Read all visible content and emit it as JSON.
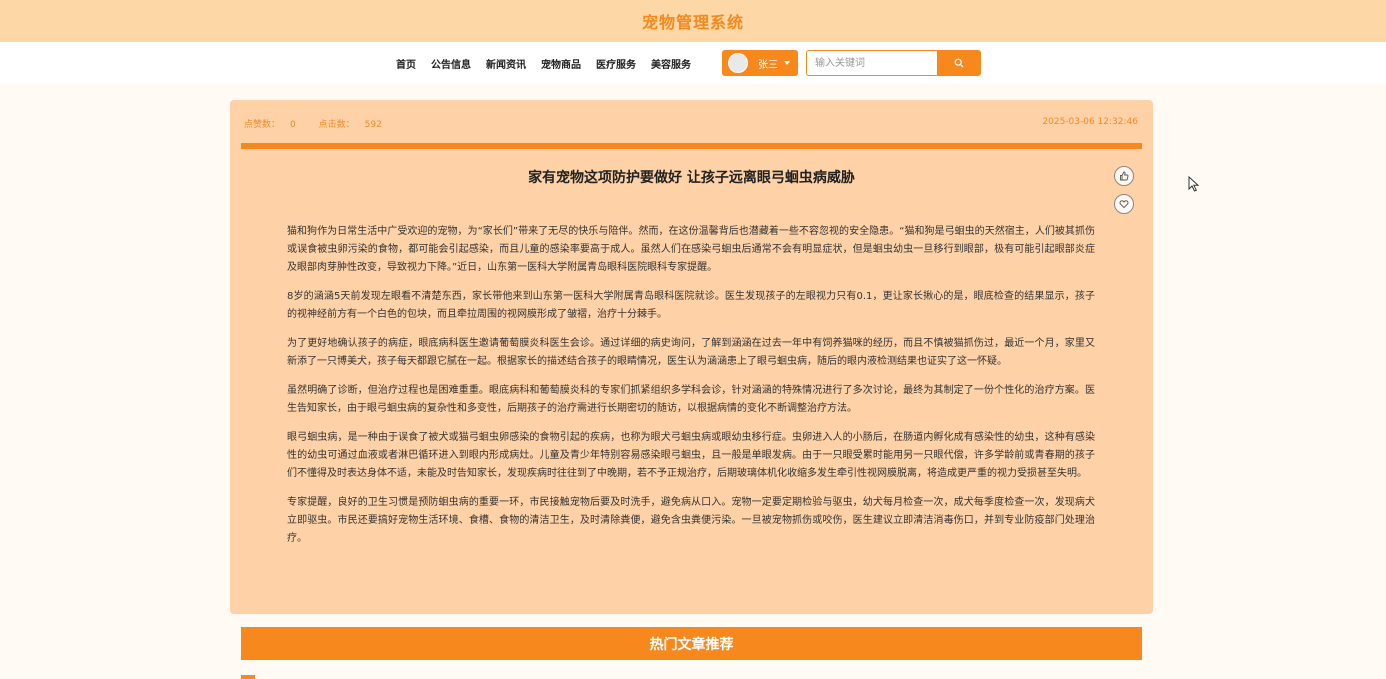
{
  "header": {
    "site_title": "宠物管理系统"
  },
  "nav": {
    "items": [
      "首页",
      "公告信息",
      "新闻资讯",
      "宠物商品",
      "医疗服务",
      "美容服务"
    ],
    "user_name": "张三",
    "search_placeholder": "输入关键词"
  },
  "article": {
    "like_label": "点赞数：",
    "like_count": "0",
    "click_label": "点击数：",
    "click_count": "592",
    "date": "2025-03-06 12:32:46",
    "title": "家有宠物这项防护要做好 让孩子远离眼弓蛔虫病威胁",
    "paragraphs": [
      "猫和狗作为日常生活中广受欢迎的宠物，为“家长们”带来了无尽的快乐与陪伴。然而，在这份温馨背后也潜藏着一些不容忽视的安全隐患。“猫和狗是弓蛔虫的天然宿主，人们被其抓伤或误食被虫卵污染的食物，都可能会引起感染，而且儿童的感染率要高于成人。虽然人们在感染弓蛔虫后通常不会有明显症状，但是蛔虫幼虫一旦移行到眼部，极有可能引起眼部炎症及眼部肉芽肿性改变，导致视力下降。”近日，山东第一医科大学附属青岛眼科医院眼科专家提醒。",
      "8岁的涵涵5天前发现左眼看不清楚东西，家长带他来到山东第一医科大学附属青岛眼科医院就诊。医生发现孩子的左眼视力只有0.1，更让家长揪心的是，眼底检查的结果显示，孩子的视神经前方有一个白色的包块，而且牵拉周围的视网膜形成了皱褶，治疗十分棘手。",
      "为了更好地确认孩子的病症，眼底病科医生邀请葡萄膜炎科医生会诊。通过详细的病史询问，了解到涵涵在过去一年中有饲养猫咪的经历，而且不慎被猫抓伤过，最近一个月，家里又新添了一只博美犬，孩子每天都跟它腻在一起。根据家长的描述结合孩子的眼睛情况，医生认为涵涵患上了眼弓蛔虫病，随后的眼内液检测结果也证实了这一怀疑。",
      "虽然明确了诊断，但治疗过程也是困难重重。眼底病科和葡萄膜炎科的专家们抓紧组织多学科会诊，针对涵涵的特殊情况进行了多次讨论，最终为其制定了一份个性化的治疗方案。医生告知家长，由于眼弓蛔虫病的复杂性和多变性，后期孩子的治疗需进行长期密切的随访，以根据病情的变化不断调整治疗方法。",
      "眼弓蛔虫病，是一种由于误食了被犬或猫弓蛔虫卵感染的食物引起的疾病，也称为眼犬弓蛔虫病或眼幼虫移行症。虫卵进入人的小肠后，在肠道内孵化成有感染性的幼虫，这种有感染性的幼虫可通过血液或者淋巴循环进入到眼内形成病灶。儿童及青少年特别容易感染眼弓蛔虫，且一般是单眼发病。由于一只眼受累时能用另一只眼代偿，许多学龄前或青春期的孩子们不懂得及时表达身体不适，未能及时告知家长，发现疾病时往往到了中晚期，若不予正规治疗，后期玻璃体机化收缩多发生牵引性视网膜脱离，将造成更严重的视力受损甚至失明。",
      "专家提醒，良好的卫生习惯是预防蛔虫病的重要一环，市民接触宠物后要及时洗手，避免病从口入。宠物一定要定期检验与驱虫，幼犬每月检查一次，成犬每季度检查一次，发现病犬立即驱虫。市民还要搞好宠物生活环境、食槽、食物的清洁卫生，及时清除粪便，避免含虫粪便污染。一旦被宠物抓伤或咬伤，医生建议立即清洁消毒伤口，并到专业防疫部门处理治疗。"
    ]
  },
  "hot": {
    "title": "热门文章推荐"
  },
  "icons": {
    "search": "search-icon",
    "like": "thumbs-up-icon",
    "favorite": "heart-icon",
    "cursor": "mouse-cursor-icon"
  },
  "colors": {
    "accent": "#f6881e",
    "card_bg": "#fed2a6",
    "header_bg": "#fdd7a6"
  }
}
